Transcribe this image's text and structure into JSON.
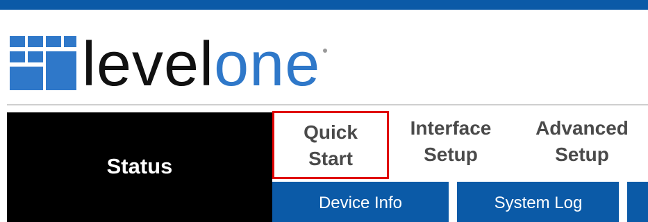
{
  "header": {
    "brand_primary": "level",
    "brand_secondary": "one",
    "accent_color": "#0b5aa7",
    "logo_color": "#2f78c9"
  },
  "nav": {
    "status_label": "Status",
    "tabs": [
      {
        "line1": "Quick",
        "line2": "Start",
        "highlighted": true
      },
      {
        "line1": "Interface",
        "line2": "Setup",
        "highlighted": false
      },
      {
        "line1": "Advanced",
        "line2": "Setup",
        "highlighted": false
      }
    ],
    "highlight_color": "#e00000"
  },
  "subnav": {
    "items": [
      {
        "label": "Device Info"
      },
      {
        "label": "System Log"
      }
    ]
  }
}
